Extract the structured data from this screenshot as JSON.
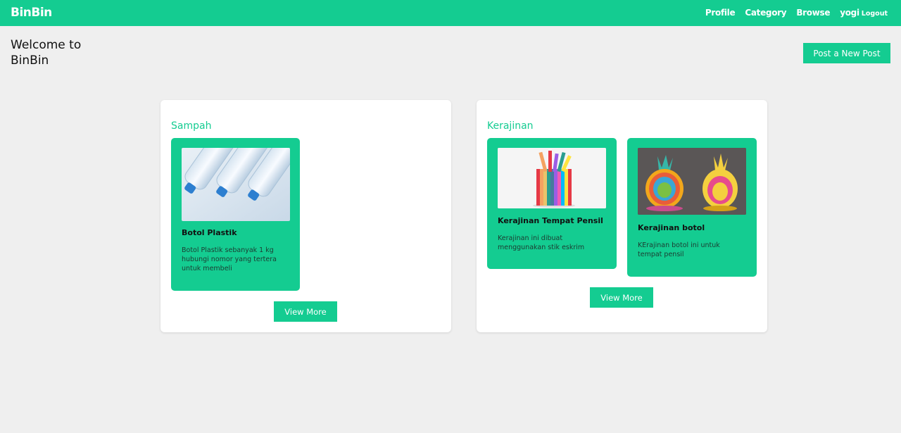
{
  "header": {
    "brand": "BinBin",
    "nav": [
      "Profile",
      "Category",
      "Browse"
    ],
    "user": "yogi",
    "logout": "Logout"
  },
  "welcome": "Welcome to BinBin",
  "post_button": "Post a New Post",
  "colors": {
    "accent": "#14cc91",
    "background": "#efefef",
    "panel": "#ffffff"
  },
  "sections": [
    {
      "title": "Sampah",
      "cards": [
        {
          "title": "Botol Plastik",
          "desc": "Botol Plastik sebanyak 1 kg hubungi nomor yang tertera untuk membeli",
          "image": "plastic-bottles-image"
        }
      ],
      "view_more": "View More"
    },
    {
      "title": "Kerajinan",
      "cards": [
        {
          "title": "Kerajinan Tempat Pensil",
          "desc": "Kerajinan ini dibuat menggunakan stik eskrim",
          "image": "pencil-holder-image"
        },
        {
          "title": "Kerajinan botol",
          "desc": "KErajinan botol ini untuk tempat pensil",
          "image": "pineapple-craft-image"
        }
      ],
      "view_more": "View More"
    }
  ]
}
